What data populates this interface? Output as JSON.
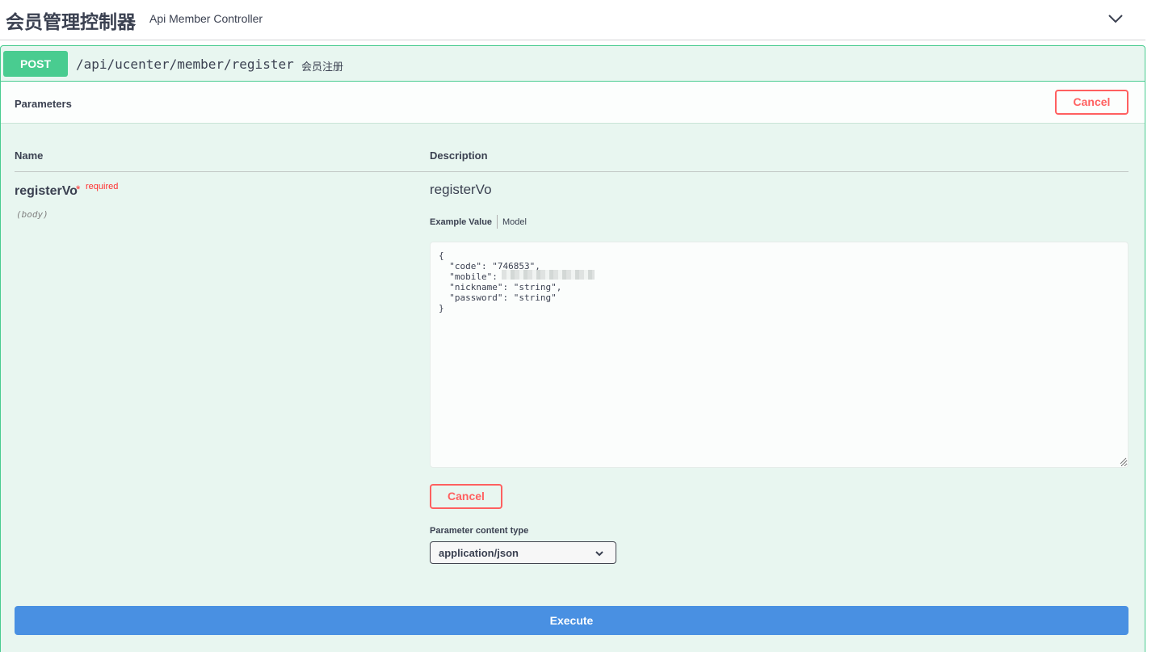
{
  "tag": {
    "name": "会员管理控制器",
    "description": "Api Member Controller"
  },
  "operation": {
    "method": "POST",
    "path": "/api/ucenter/member/register",
    "summary": "会员注册"
  },
  "parameters": {
    "title": "Parameters",
    "cancel_label": "Cancel",
    "columns": {
      "name": "Name",
      "description": "Description"
    },
    "param": {
      "name": "registerVo",
      "star": "*",
      "required": "required",
      "in": "(body)",
      "description": "registerVo"
    },
    "tabs": {
      "example": "Example Value",
      "model": "Model"
    },
    "body_value": "{\n  \"code\": \"746853\",\n  \"mobile\": \n  \"nickname\": \"string\",\n  \"password\": \"string\"\n}",
    "content_type_label": "Parameter content type",
    "content_type_value": "application/json"
  },
  "execute_label": "Execute",
  "colors": {
    "post": "#49cc90",
    "cancel": "#ff6060",
    "execute": "#4990e2"
  }
}
